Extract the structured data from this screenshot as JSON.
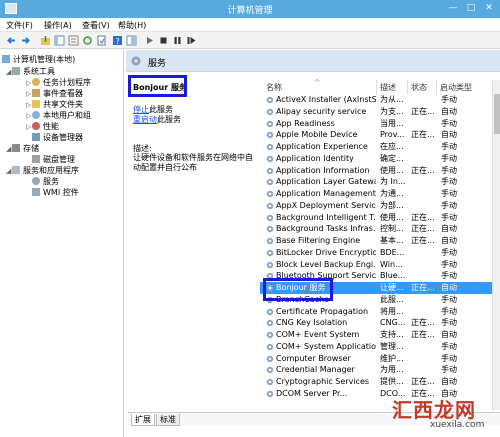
{
  "window": {
    "title": "计算机管理",
    "minimize": "—",
    "maximize": "□",
    "close": "✕"
  },
  "menu": {
    "file": "文件(F)",
    "action": "操作(A)",
    "view": "查看(V)",
    "help": "帮助(H)"
  },
  "tree": {
    "root": "计算机管理(本地)",
    "system_tools": "系统工具",
    "task_scheduler": "任务计划程序",
    "event_viewer": "事件查看器",
    "shared_folders": "共享文件夹",
    "local_users": "本地用户和组",
    "performance": "性能",
    "device_manager": "设备管理器",
    "storage": "存储",
    "disk_management": "磁盘管理",
    "services_apps": "服务和应用程序",
    "services": "服务",
    "wmi": "WMI 控件"
  },
  "header": {
    "label": "服务"
  },
  "detail": {
    "title": "Bonjour 服务",
    "stop_prefix": "停止",
    "stop_suffix": "此服务",
    "restart_prefix": "重启动",
    "restart_suffix": "此服务",
    "desc_label": "描述:",
    "desc_text": "让硬件设备和软件服务在网络中自动配置并自行公布"
  },
  "columns": {
    "name": "名称",
    "desc": "描述",
    "status": "状态",
    "startup": "启动类型",
    "sort_arrow": "^"
  },
  "services": [
    {
      "name": "ActiveX Installer (AxInstSV)",
      "desc": "为从...",
      "status": "",
      "startup": "手动"
    },
    {
      "name": "Alipay security service",
      "desc": "为支...",
      "status": "正在...",
      "startup": "自动"
    },
    {
      "name": "App Readiness",
      "desc": "当用...",
      "status": "",
      "startup": "手动"
    },
    {
      "name": "Apple Mobile Device",
      "desc": "Prov...",
      "status": "正在...",
      "startup": "自动"
    },
    {
      "name": "Application Experience",
      "desc": "在应...",
      "status": "",
      "startup": "手动"
    },
    {
      "name": "Application Identity",
      "desc": "确定...",
      "status": "",
      "startup": "手动"
    },
    {
      "name": "Application Information",
      "desc": "使用...",
      "status": "正在...",
      "startup": "手动"
    },
    {
      "name": "Application Layer Gatewa...",
      "desc": "为 In...",
      "status": "",
      "startup": "手动"
    },
    {
      "name": "Application Management",
      "desc": "为通...",
      "status": "",
      "startup": "手动"
    },
    {
      "name": "AppX Deployment Servic...",
      "desc": "为部...",
      "status": "",
      "startup": "手动"
    },
    {
      "name": "Background Intelligent T...",
      "desc": "使用...",
      "status": "正在...",
      "startup": "手动"
    },
    {
      "name": "Background Tasks Infras...",
      "desc": "控制...",
      "status": "正在...",
      "startup": "自动"
    },
    {
      "name": "Base Filtering Engine",
      "desc": "基本...",
      "status": "正在...",
      "startup": "自动"
    },
    {
      "name": "BitLocker Drive Encryptio...",
      "desc": "BDE...",
      "status": "",
      "startup": "手动"
    },
    {
      "name": "Block Level Backup Engi...",
      "desc": "Win...",
      "status": "",
      "startup": "手动"
    },
    {
      "name": "Bluetooth Support Service",
      "desc": "Blue...",
      "status": "",
      "startup": "手动"
    },
    {
      "name": "Bonjour 服务",
      "desc": "让硬...",
      "status": "正在...",
      "startup": "自动"
    },
    {
      "name": "BranchCache",
      "desc": "此服...",
      "status": "",
      "startup": "手动"
    },
    {
      "name": "Certificate Propagation",
      "desc": "将用...",
      "status": "",
      "startup": "手动"
    },
    {
      "name": "CNG Key Isolation",
      "desc": "CNG...",
      "status": "正在...",
      "startup": "手动"
    },
    {
      "name": "COM+ Event System",
      "desc": "支持...",
      "status": "正在...",
      "startup": "自动"
    },
    {
      "name": "COM+ System Application",
      "desc": "管理...",
      "status": "",
      "startup": "手动"
    },
    {
      "name": "Computer Browser",
      "desc": "维护...",
      "status": "",
      "startup": "手动"
    },
    {
      "name": "Credential Manager",
      "desc": "为用...",
      "status": "",
      "startup": "手动"
    },
    {
      "name": "Cryptographic Services",
      "desc": "提供...",
      "status": "正在...",
      "startup": "自动"
    },
    {
      "name": "DCOM Server Pr...",
      "desc": "DCO...",
      "status": "正在...",
      "startup": "自动"
    }
  ],
  "tabs": {
    "extended": "扩展",
    "standard": "标准"
  },
  "watermark": {
    "big": "汇西龙网",
    "small": "xuexila.com"
  },
  "colors": {
    "titlebar": "#58a9de",
    "selection": "#3399ff",
    "highlight_box": "#1a1ad6",
    "header": "#dbe6f4"
  }
}
